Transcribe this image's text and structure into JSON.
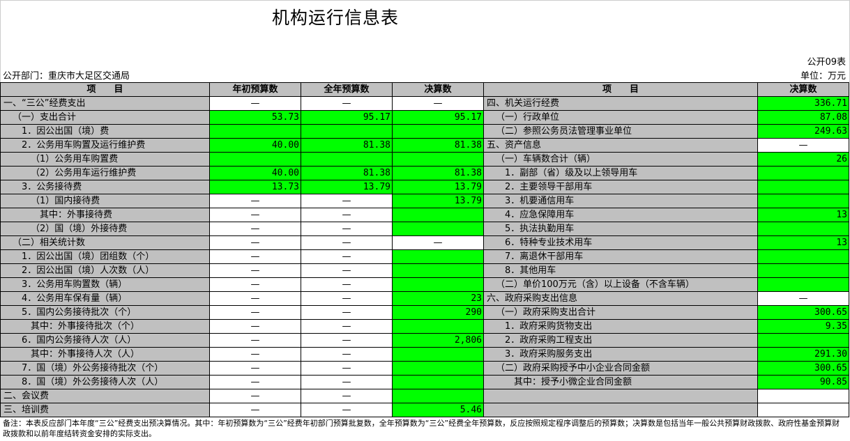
{
  "title": "机构运行信息表",
  "form_code": "公开09表",
  "department": "公开部门：重庆市大足区交通局",
  "unit": "单位：万元",
  "headers": {
    "item": "项　　目",
    "budget_initial": "年初预算数",
    "budget_full": "全年预算数",
    "final": "决算数",
    "item_right": "项　　目",
    "final_right": "决算数"
  },
  "rows": [
    {
      "left": "一、“三公”经费支出",
      "a": "—",
      "b": "—",
      "c": "—",
      "ac": "w",
      "bc": "w",
      "cc": "w",
      "right": "四、机关运行经费",
      "d": "336.71",
      "dc": "g"
    },
    {
      "left": "（一）支出合计",
      "a": "53.73",
      "b": "95.17",
      "c": "95.17",
      "ac": "g",
      "bc": "g",
      "cc": "g",
      "right": "（一）行政单位",
      "d": "87.08",
      "dc": "g"
    },
    {
      "left": "1．因公出国（境）费",
      "a": "",
      "b": "",
      "c": "",
      "ac": "g",
      "bc": "g",
      "cc": "g",
      "right": "（二）参照公务员法管理事业单位",
      "d": "249.63",
      "dc": "g"
    },
    {
      "left": "2．公务用车购置及运行维护费",
      "a": "40.00",
      "b": "81.38",
      "c": "81.38",
      "ac": "g",
      "bc": "g",
      "cc": "g",
      "right": "五、资产信息",
      "d": "—",
      "dc": "w"
    },
    {
      "left": "（1）公务用车购置费",
      "a": "",
      "b": "",
      "c": "",
      "ac": "g",
      "bc": "g",
      "cc": "g",
      "right": "（一）车辆数合计（辆）",
      "d": "26",
      "dc": "g"
    },
    {
      "left": "（2）公务用车运行维护费",
      "a": "40.00",
      "b": "81.38",
      "c": "81.38",
      "ac": "g",
      "bc": "g",
      "cc": "g",
      "right": "1．副部（省）级及以上领导用车",
      "d": "",
      "dc": "g"
    },
    {
      "left": "3．公务接待费",
      "a": "13.73",
      "b": "13.79",
      "c": "13.79",
      "ac": "g",
      "bc": "g",
      "cc": "g",
      "right": "2．主要领导干部用车",
      "d": "",
      "dc": "g"
    },
    {
      "left": "（1）国内接待费",
      "a": "—",
      "b": "—",
      "c": "13.79",
      "ac": "w",
      "bc": "w",
      "cc": "g",
      "right": "3．机要通信用车",
      "d": "",
      "dc": "g"
    },
    {
      "left": "其中：外事接待费",
      "a": "—",
      "b": "—",
      "c": "",
      "ac": "w",
      "bc": "w",
      "cc": "g",
      "right": "4．应急保障用车",
      "d": "13",
      "dc": "g"
    },
    {
      "left": "（2）国（境）外接待费",
      "a": "—",
      "b": "—",
      "c": "",
      "ac": "w",
      "bc": "w",
      "cc": "g",
      "right": "5．执法执勤用车",
      "d": "",
      "dc": "g"
    },
    {
      "left": "（二）相关统计数",
      "a": "—",
      "b": "—",
      "c": "—",
      "ac": "w",
      "bc": "w",
      "cc": "w",
      "right": "6．特种专业技术用车",
      "d": "13",
      "dc": "g"
    },
    {
      "left": "1．因公出国（境）团组数（个）",
      "a": "—",
      "b": "—",
      "c": "",
      "ac": "w",
      "bc": "w",
      "cc": "g",
      "right": "7．离退休干部用车",
      "d": "",
      "dc": "g"
    },
    {
      "left": "2．因公出国（境）人次数（人）",
      "a": "—",
      "b": "—",
      "c": "",
      "ac": "w",
      "bc": "w",
      "cc": "g",
      "right": "8．其他用车",
      "d": "",
      "dc": "g"
    },
    {
      "left": "3．公务用车购置数（辆）",
      "a": "—",
      "b": "—",
      "c": "",
      "ac": "w",
      "bc": "w",
      "cc": "g",
      "right": "（二）单价100万元（含）以上设备（不含车辆）",
      "d": "",
      "dc": "g"
    },
    {
      "left": "4．公务用车保有量（辆）",
      "a": "—",
      "b": "—",
      "c": "23",
      "ac": "w",
      "bc": "w",
      "cc": "g",
      "right": "六、政府采购支出信息",
      "d": "—",
      "dc": "w"
    },
    {
      "left": "5．国内公务接待批次（个）",
      "a": "—",
      "b": "—",
      "c": "290",
      "ac": "w",
      "bc": "w",
      "cc": "g",
      "right": "（一）政府采购支出合计",
      "d": "300.65",
      "dc": "g"
    },
    {
      "left": "其中：外事接待批次（个）",
      "a": "—",
      "b": "—",
      "c": "",
      "ac": "w",
      "bc": "w",
      "cc": "g",
      "right": "1．政府采购货物支出",
      "d": "9.35",
      "dc": "g"
    },
    {
      "left": "6．国内公务接待人次（人）",
      "a": "—",
      "b": "—",
      "c": "2,806",
      "ac": "w",
      "bc": "w",
      "cc": "g",
      "right": "2．政府采购工程支出",
      "d": "",
      "dc": "g"
    },
    {
      "left": "其中：外事接待人次（人）",
      "a": "—",
      "b": "—",
      "c": "",
      "ac": "w",
      "bc": "w",
      "cc": "g",
      "right": "3．政府采购服务支出",
      "d": "291.30",
      "dc": "g"
    },
    {
      "left": "7．国（境）外公务接待批次（个）",
      "a": "—",
      "b": "—",
      "c": "",
      "ac": "w",
      "bc": "w",
      "cc": "g",
      "right": "（二）政府采购授予中小企业合同金额",
      "d": "300.65",
      "dc": "g"
    },
    {
      "left": "8．国（境）外公务接待人次（人）",
      "a": "—",
      "b": "—",
      "c": "",
      "ac": "w",
      "bc": "w",
      "cc": "g",
      "right": "其中：授予小微企业合同金额",
      "d": "90.85",
      "dc": "g"
    },
    {
      "left": "二、会议费",
      "a": "—",
      "b": "—",
      "c": "",
      "ac": "w",
      "bc": "w",
      "cc": "g",
      "right": "",
      "d": "",
      "dc": "w"
    },
    {
      "left": "三、培训费",
      "a": "—",
      "b": "—",
      "c": "5.46",
      "ac": "w",
      "bc": "w",
      "cc": "g",
      "right": "",
      "d": "",
      "dc": "w"
    }
  ],
  "note": "备注：本表反应部门本年度“三公”经费支出预决算情况。其中：年初预算数为“三公”经费年初部门预算批复数，全年预算数为“三公”经费全年预算数，反应按照规定程序调整后的预算数；决算数是包括当年一般公共预算财政拨款、政府性基金预算财政拨款和以前年度结转资金安排的实际支出。",
  "colors": {
    "green": "#00ff00",
    "gray": "#c0c0c0"
  }
}
